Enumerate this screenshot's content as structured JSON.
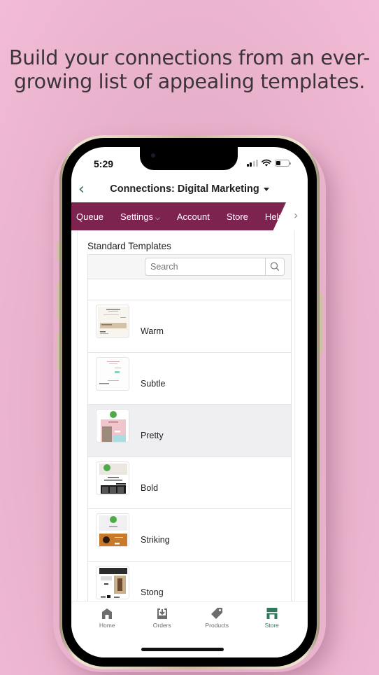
{
  "headline": {
    "line1": "Build your connections from an ever-",
    "line2": "growing list of appealing templates."
  },
  "status_bar": {
    "time": "5:29",
    "signal_bars": 2,
    "signal_total": 4,
    "battery_level": 0.35
  },
  "navbar": {
    "back_icon": "chevron-left-icon",
    "title": "Connections: Digital Marketing",
    "title_dropdown_icon": "caret-down-icon"
  },
  "menu": {
    "items": [
      {
        "label": "Queue"
      },
      {
        "label": "Settings",
        "has_dropdown": true,
        "dropdown_glyph": "⌵"
      },
      {
        "label": "Account"
      },
      {
        "label": "Store"
      },
      {
        "label": "Help"
      }
    ],
    "next_glyph": "›",
    "accent_color": "#7c2350"
  },
  "templates": {
    "section_title": "Standard Templates",
    "search": {
      "placeholder": "Search"
    },
    "rows": [
      {
        "name": "Warm",
        "selected": false
      },
      {
        "name": "Subtle",
        "selected": false
      },
      {
        "name": "Pretty",
        "selected": true
      },
      {
        "name": "Bold",
        "selected": false
      },
      {
        "name": "Striking",
        "selected": false
      },
      {
        "name": "Stong",
        "selected": false
      }
    ]
  },
  "tabbar": {
    "tabs": [
      {
        "label": "Home",
        "icon": "home-icon",
        "active": false
      },
      {
        "label": "Orders",
        "icon": "orders-inbox-icon",
        "active": false
      },
      {
        "label": "Products",
        "icon": "tag-icon",
        "active": false
      },
      {
        "label": "Store",
        "icon": "storefront-icon",
        "active": true
      }
    ],
    "active_color": "#2f7a5a",
    "inactive_color": "#6d6d6d"
  }
}
